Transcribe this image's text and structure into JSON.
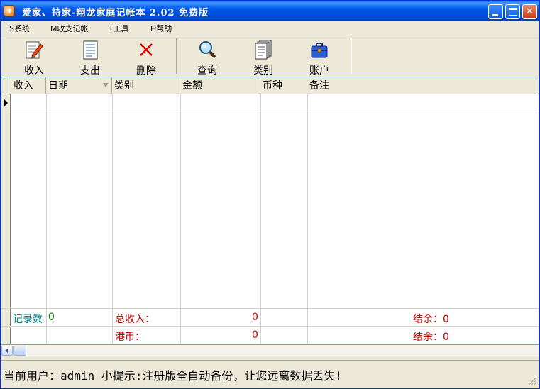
{
  "window": {
    "title": "爱家、持家-翔龙家庭记帐本 2.02 免费版"
  },
  "menu": [
    {
      "label": "S系统"
    },
    {
      "label": "M收支记帐"
    },
    {
      "label": "T工具"
    },
    {
      "label": "H帮助"
    }
  ],
  "toolbar": [
    {
      "label": "收入",
      "icon": "edit-icon"
    },
    {
      "label": "支出",
      "icon": "document-icon"
    },
    {
      "label": "删除",
      "icon": "delete-x-icon"
    },
    {
      "label": "查询",
      "icon": "magnifier-icon"
    },
    {
      "label": "类别",
      "icon": "documents-icon"
    },
    {
      "label": "账户",
      "icon": "toolbox-icon"
    }
  ],
  "grid": {
    "columns": [
      "收入",
      "日期",
      "类别",
      "金额",
      "币种",
      "备注"
    ],
    "rows": [],
    "summary": {
      "record_count_label": "记录数",
      "record_count_value": "0",
      "total_income_label": "总收入：",
      "total_income_value": "0",
      "balance1_label": "结余：0",
      "hkd_label": "港币：",
      "hkd_value": "0",
      "balance2_label": "结余：0"
    }
  },
  "status": {
    "text": "当前用户：admin   小提示:注册版全自动备份，让您远离数据丢失!"
  },
  "colors": {
    "titlebar": "#0058E6",
    "window_bg": "#ECE9D8",
    "summary_teal": "#008080",
    "summary_red": "#C00000"
  }
}
